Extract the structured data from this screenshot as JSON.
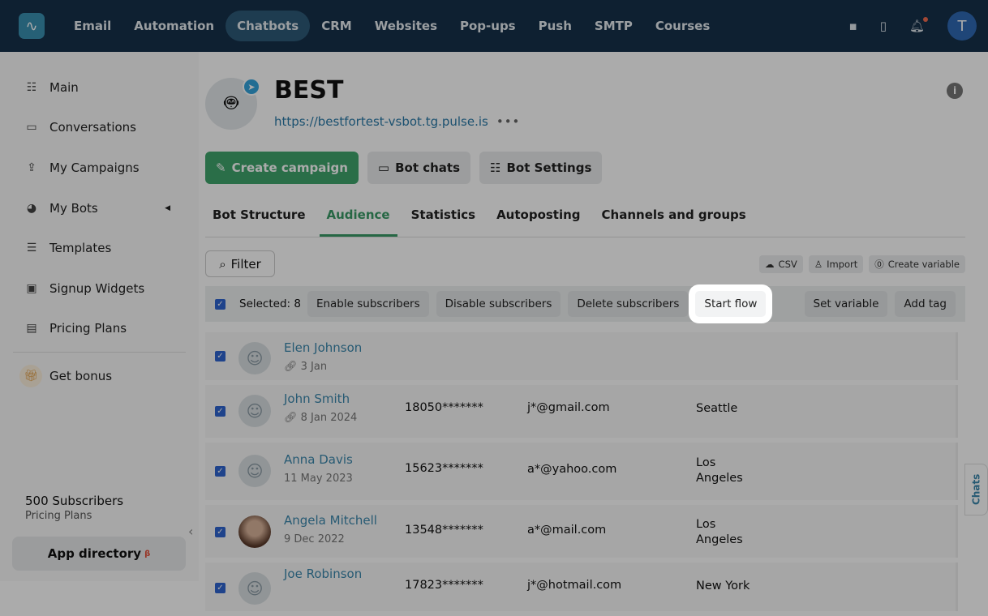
{
  "topnav": {
    "items": [
      "Email",
      "Automation",
      "Chatbots",
      "CRM",
      "Websites",
      "Pop-ups",
      "Push",
      "SMTP",
      "Courses"
    ],
    "active": "Chatbots",
    "avatar": "T"
  },
  "sidebar": {
    "items": [
      "Main",
      "Conversations",
      "My Campaigns",
      "My Bots",
      "Templates",
      "Signup Widgets",
      "Pricing Plans"
    ],
    "bonus": "Get bonus",
    "subscribers": "500 Subscribers",
    "plan": "Pricing Plans",
    "app_directory": "App directory",
    "beta": "β"
  },
  "bot": {
    "name": "BEST",
    "url": "https://bestfortest-vsbot.tg.pulse.is",
    "more": "•••"
  },
  "actions": {
    "create": "Create campaign",
    "chats": "Bot chats",
    "settings": "Bot Settings"
  },
  "tabs": [
    "Bot Structure",
    "Audience",
    "Statistics",
    "Autoposting",
    "Channels and groups"
  ],
  "tools": {
    "filter": "Filter",
    "csv": "CSV",
    "import": "Import",
    "create_var": "Create variable"
  },
  "bulk": {
    "selected": "Selected: 8",
    "enable": "Enable subscribers",
    "disable": "Disable subscribers",
    "delete": "Delete subscribers",
    "start_flow": "Start flow",
    "set_var": "Set variable",
    "add_tag": "Add tag"
  },
  "rows": [
    {
      "name": "Elen Johnson",
      "date": "3 Jan",
      "phone": "",
      "email": "",
      "city": ""
    },
    {
      "name": "John Smith",
      "date": "8 Jan 2024",
      "phone": "18050*******",
      "email": "j*@gmail.com",
      "city": "Seattle"
    },
    {
      "name": "Anna Davis",
      "date": "11 May 2023",
      "phone": "15623*******",
      "email": "a*@yahoo.com",
      "city": "Los Angeles"
    },
    {
      "name": "Angela Mitchell",
      "date": "9 Dec 2022",
      "phone": "13548*******",
      "email": "a*@mail.com",
      "city": "Los Angeles"
    },
    {
      "name": "Joe Robinson",
      "date": "",
      "phone": "17823*******",
      "email": "j*@hotmail.com",
      "city": "New York"
    }
  ],
  "chats_tab": "Chats"
}
